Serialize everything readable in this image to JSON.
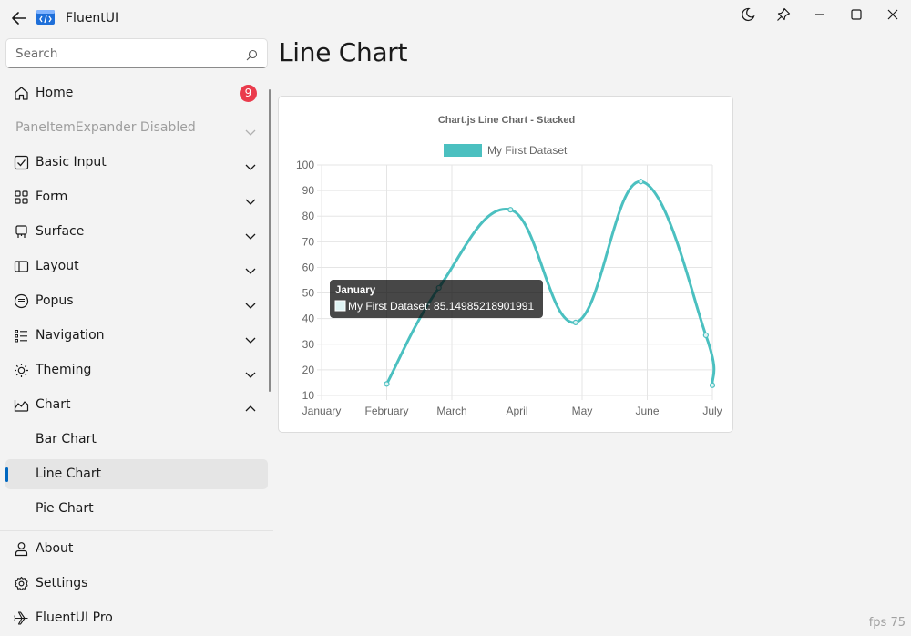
{
  "window": {
    "title": "FluentUI",
    "icons": [
      "back-icon",
      "app-logo-icon",
      "dark-mode-icon",
      "pin-icon",
      "minimize-icon",
      "maximize-icon",
      "close-icon"
    ]
  },
  "search": {
    "placeholder": "Search"
  },
  "sidebar": {
    "items": [
      {
        "label": "Home",
        "icon": "home-icon",
        "badge": "9"
      },
      {
        "label": "PaneItemExpander Disabled",
        "disabled": true
      },
      {
        "label": "Basic Input",
        "icon": "checkbox-icon"
      },
      {
        "label": "Form",
        "icon": "grid-icon"
      },
      {
        "label": "Surface",
        "icon": "surface-icon"
      },
      {
        "label": "Layout",
        "icon": "layout-icon"
      },
      {
        "label": "Popus",
        "icon": "popup-icon"
      },
      {
        "label": "Navigation",
        "icon": "list-icon"
      },
      {
        "label": "Theming",
        "icon": "sun-icon"
      },
      {
        "label": "Chart",
        "icon": "chart-icon",
        "expanded": true
      },
      {
        "label": "Bar Chart"
      },
      {
        "label": "Line Chart",
        "selected": true
      },
      {
        "label": "Pie Chart"
      }
    ],
    "footer": [
      {
        "label": "About",
        "icon": "person-icon"
      },
      {
        "label": "Settings",
        "icon": "gear-icon"
      },
      {
        "label": "FluentUI Pro",
        "icon": "plane-icon"
      }
    ]
  },
  "main": {
    "title": "Line Chart"
  },
  "status": {
    "fps": "fps 75"
  },
  "chart_data": {
    "type": "line",
    "title": "Chart.js Line Chart - Stacked",
    "categories": [
      "January",
      "February",
      "March",
      "April",
      "May",
      "June",
      "July"
    ],
    "series": [
      {
        "name": "My First Dataset",
        "color": "#4bc0c0",
        "values": [
          85.1,
          14.5,
          52,
          82.5,
          38.5,
          93.5,
          33.5,
          14
        ]
      }
    ],
    "x": [
      0,
      1,
      1.8,
      2.9,
      3.9,
      4.9,
      5.9,
      6.0
    ],
    "ylim": [
      10,
      100
    ],
    "yticks": [
      10,
      20,
      30,
      40,
      50,
      60,
      70,
      80,
      90,
      100
    ],
    "grid": true,
    "legend": "top",
    "tooltip": {
      "title": "January",
      "text": "My First Dataset: 85.14985218901991"
    }
  }
}
